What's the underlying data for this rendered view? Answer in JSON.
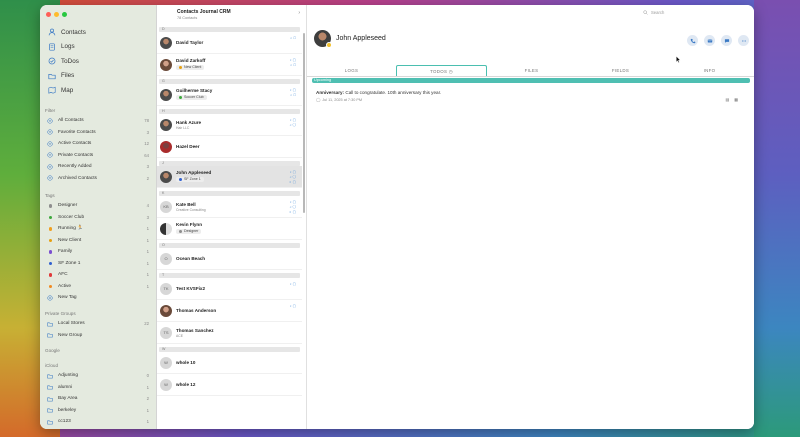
{
  "sidebar": {
    "nav": [
      {
        "label": "Contacts",
        "icon": "person-icon"
      },
      {
        "label": "Logs",
        "icon": "document-icon"
      },
      {
        "label": "ToDos",
        "icon": "checkmark-circle-icon"
      },
      {
        "label": "Files",
        "icon": "folder-icon"
      },
      {
        "label": "Map",
        "icon": "map-icon"
      }
    ],
    "filter_header": "Filter",
    "filters": [
      {
        "label": "All Contacts",
        "count": "78"
      },
      {
        "label": "Favorite Contacts",
        "count": "3"
      },
      {
        "label": "Active Contacts",
        "count": "12"
      },
      {
        "label": "Private Contacts",
        "count": "64"
      },
      {
        "label": "Recently Added",
        "count": "3"
      },
      {
        "label": "Archived Contacts",
        "count": "2"
      }
    ],
    "tags_header": "Tags",
    "tags": [
      {
        "label": "Designer",
        "count": "4",
        "color": "#8e8e8e"
      },
      {
        "label": "Soccer Club",
        "count": "3",
        "color": "#3ca83c"
      },
      {
        "label": "Running 🏃",
        "count": "1",
        "color": "#f0a020"
      },
      {
        "label": "New Client",
        "count": "1",
        "color": "#e6a010"
      },
      {
        "label": "Family",
        "count": "1",
        "color": "#7b4fd0"
      },
      {
        "label": "SF Zone 1",
        "count": "1",
        "color": "#3060d0"
      },
      {
        "label": "AFC",
        "count": "1",
        "color": "#e03a3a"
      },
      {
        "label": "Active",
        "count": "1",
        "color": "#f08a20"
      },
      {
        "label": "New Tag",
        "count": "",
        "color": ""
      }
    ],
    "private_groups_header": "Private Groups",
    "private_groups": [
      {
        "label": "Local Stores",
        "count": "22"
      },
      {
        "label": "New Group",
        "count": ""
      }
    ],
    "google_header": "Google",
    "icloud_header": "iCloud",
    "icloud_groups": [
      {
        "label": "Adjunting",
        "count": "0"
      },
      {
        "label": "alumni",
        "count": "1"
      },
      {
        "label": "Bay Area",
        "count": "2"
      },
      {
        "label": "berkeley",
        "count": "1"
      },
      {
        "label": "cc123",
        "count": "1"
      }
    ]
  },
  "list": {
    "title": "Contacts Journal CRM",
    "subtitle": "78 Contacts",
    "rows": [
      {
        "kind": "letter",
        "label": "D"
      },
      {
        "kind": "contact",
        "name": "David Taylor",
        "sub": "",
        "tag": "",
        "tag_color": "",
        "avatar": "av-photo",
        "initials": "",
        "icons": "⌕ ▢",
        "selected": false
      },
      {
        "kind": "contact",
        "name": "David Zarkoff",
        "sub": "",
        "tag": "New Client",
        "tag_color": "#e6a010",
        "avatar": "av-photo2",
        "initials": "",
        "icons": "♪ ▢|⌕ ▢",
        "selected": false
      },
      {
        "kind": "letter",
        "label": "G"
      },
      {
        "kind": "contact",
        "name": "Guilherme Stacy",
        "sub": "",
        "tag": "Soccer Club",
        "tag_color": "#3ca83c",
        "avatar": "av-photo",
        "initials": "",
        "icons": "♪ ▢|⌕ ▢",
        "selected": false
      },
      {
        "kind": "letter",
        "label": "H"
      },
      {
        "kind": "contact",
        "name": "Hank Azure",
        "sub": "Hair LLC",
        "tag": "",
        "tag_color": "",
        "avatar": "av-photo",
        "initials": "",
        "icons": "♪ ▢|⌕ ◯",
        "selected": false
      },
      {
        "kind": "contact",
        "name": "Hazel Deer",
        "sub": "",
        "tag": "",
        "tag_color": "",
        "avatar": "av-photo3",
        "initials": "",
        "icons": "",
        "selected": false
      },
      {
        "kind": "letter",
        "label": "J"
      },
      {
        "kind": "contact",
        "name": "John Appleseed",
        "sub": "",
        "tag": "SF Zone 1",
        "tag_color": "#3060d0",
        "avatar": "av-photo",
        "initials": "",
        "icons": "♪ ▢|⌕ ◯|◐ ▢",
        "selected": true
      },
      {
        "kind": "letter",
        "label": "K"
      },
      {
        "kind": "contact",
        "name": "Kate Bell",
        "sub": "Creative Consulting",
        "tag": "",
        "tag_color": "",
        "avatar": "av-init",
        "initials": "KB",
        "icons": "♪ ▢|⌕ ◯|◐ ▢",
        "selected": false
      },
      {
        "kind": "contact",
        "name": "Kevin Flynn",
        "sub": "",
        "tag": "Designer",
        "tag_color": "#8e8e8e",
        "avatar": "av-photo4",
        "initials": "",
        "icons": "",
        "selected": false
      },
      {
        "kind": "letter",
        "label": "O"
      },
      {
        "kind": "contact",
        "name": "Ocean Beach",
        "sub": "",
        "tag": "",
        "tag_color": "",
        "avatar": "av-init",
        "initials": "O",
        "icons": "",
        "selected": false
      },
      {
        "kind": "letter",
        "label": "T"
      },
      {
        "kind": "contact",
        "name": "Test KVSFix2",
        "sub": "",
        "tag": "",
        "tag_color": "",
        "avatar": "av-init",
        "initials": "TK",
        "icons": "♪ ▢",
        "selected": false
      },
      {
        "kind": "contact",
        "name": "Thomas Anderson",
        "sub": "",
        "tag": "",
        "tag_color": "",
        "avatar": "av-photo2",
        "initials": "",
        "icons": "♪ ▢",
        "selected": false
      },
      {
        "kind": "contact",
        "name": "Thomas Sanchez",
        "sub": "ACE",
        "tag": "",
        "tag_color": "",
        "avatar": "av-init",
        "initials": "TS",
        "icons": "",
        "selected": false
      },
      {
        "kind": "letter",
        "label": "W"
      },
      {
        "kind": "contact",
        "name": "whole 10",
        "sub": "",
        "tag": "",
        "tag_color": "",
        "avatar": "av-init",
        "initials": "W",
        "icons": "",
        "selected": false
      },
      {
        "kind": "contact",
        "name": "whole 12",
        "sub": "",
        "tag": "",
        "tag_color": "",
        "avatar": "av-init",
        "initials": "W",
        "icons": "",
        "selected": false
      }
    ]
  },
  "detail": {
    "search_placeholder": "Search",
    "name": "John Appleseed",
    "tabs": [
      "LOGS",
      "TODOS",
      "FILES",
      "FIELDS",
      "INFO"
    ],
    "active_tab": "TODOS",
    "todos_count_badge": "◷",
    "upcoming_label": "Upcoming",
    "todo": {
      "title_bold": "Anniversary:",
      "title_rest": " Call to congratulate. 10th anniversary this year.",
      "date": "Jul 11, 2025 at 7:30 PM"
    }
  },
  "colors": {
    "accent_teal": "#4fbfb2",
    "action_blue": "#3a79c4",
    "sidebar_bg": "#e4eadf"
  }
}
